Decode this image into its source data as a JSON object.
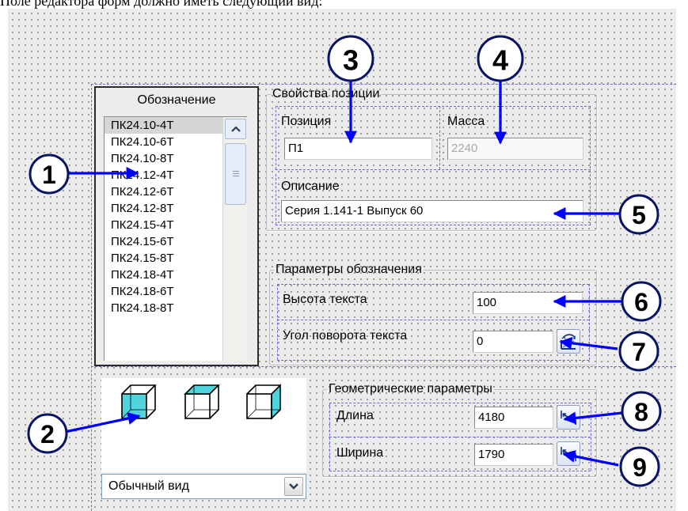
{
  "caption": "Поле редактора форм должно иметь следующий вид:",
  "designation_list": {
    "title": "Обозначение",
    "items": [
      "ПК24.10-4Т",
      "ПК24.10-6Т",
      "ПК24.10-8Т",
      "ПК24.12-4Т",
      "ПК24.12-6Т",
      "ПК24.12-8Т",
      "ПК24.15-4Т",
      "ПК24.15-6Т",
      "ПК24.15-8Т",
      "ПК24.18-4Т",
      "ПК24.18-6Т",
      "ПК24.18-8Т"
    ],
    "selected": "ПК24.10-4Т"
  },
  "position_props": {
    "legend": "Свойства позиции",
    "position_label": "Позиция",
    "position_value": "П1",
    "mass_label": "Масса",
    "mass_value": "2240",
    "description_label": "Описание",
    "description_value": "Серия 1.141-1 Выпуск 60"
  },
  "designation_params": {
    "legend": "Параметры обозначения",
    "text_height_label": "Высота текста",
    "text_height_value": "100",
    "text_angle_label": "Угол поворота текста",
    "text_angle_value": "0"
  },
  "geometry_params": {
    "legend": "Геометрические параметры",
    "length_label": "Длина",
    "length_value": "4180",
    "width_label": "Ширина",
    "width_value": "1790"
  },
  "view": {
    "icons": [
      "cube-front-face-icon",
      "cube-top-face-icon",
      "cube-side-face-icon"
    ],
    "selected_value": "Обычный вид"
  },
  "callouts": [
    "1",
    "2",
    "3",
    "4",
    "5",
    "6",
    "7",
    "8",
    "9"
  ],
  "colors": {
    "cube_fill": "#4fd3dc",
    "callout_stroke": "#0a1464",
    "arrow": "#0000ff",
    "guide": "#6b6bd6",
    "canvas": "#ececec"
  }
}
